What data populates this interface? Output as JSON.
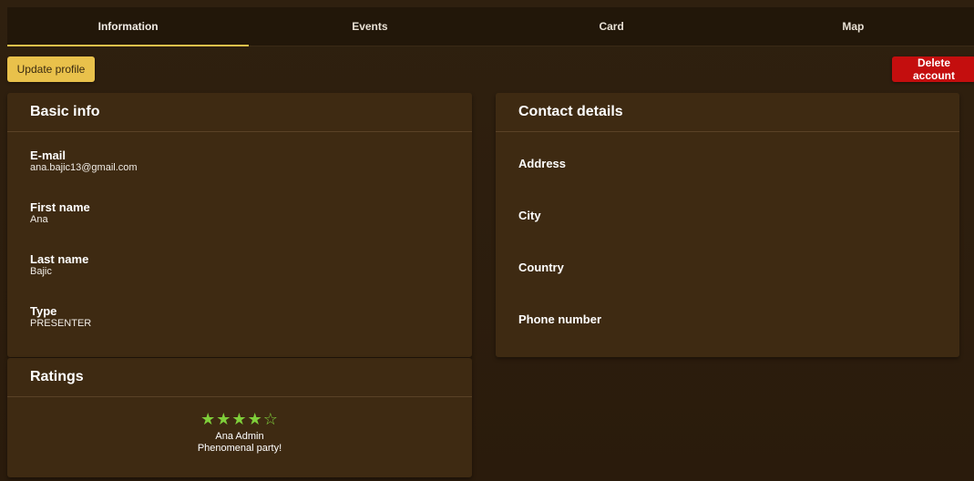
{
  "tabs": [
    {
      "label": "Information",
      "active": true
    },
    {
      "label": "Events",
      "active": false
    },
    {
      "label": "Card",
      "active": false
    },
    {
      "label": "Map",
      "active": false
    }
  ],
  "actions": {
    "update_label": "Update profile",
    "delete_label": "Delete account"
  },
  "basic_info": {
    "title": "Basic info",
    "fields": [
      {
        "label": "E-mail",
        "value": "ana.bajic13@gmail.com"
      },
      {
        "label": "First name",
        "value": "Ana"
      },
      {
        "label": "Last name",
        "value": "Bajic"
      },
      {
        "label": "Type",
        "value": "PRESENTER"
      }
    ]
  },
  "contact_details": {
    "title": "Contact details",
    "fields": [
      {
        "label": "Address"
      },
      {
        "label": "City"
      },
      {
        "label": "Country"
      },
      {
        "label": "Phone number"
      }
    ]
  },
  "ratings": {
    "title": "Ratings",
    "items": [
      {
        "stars": "★★★★☆",
        "rating": 4,
        "max": 5,
        "author": "Ana Admin",
        "comment": "Phenomenal party!"
      }
    ]
  },
  "colors": {
    "accent": "#e9c14b",
    "danger": "#c40e0e",
    "star": "#7fcf3a",
    "card": "#3e2a12",
    "background": "#2e1f0e"
  }
}
